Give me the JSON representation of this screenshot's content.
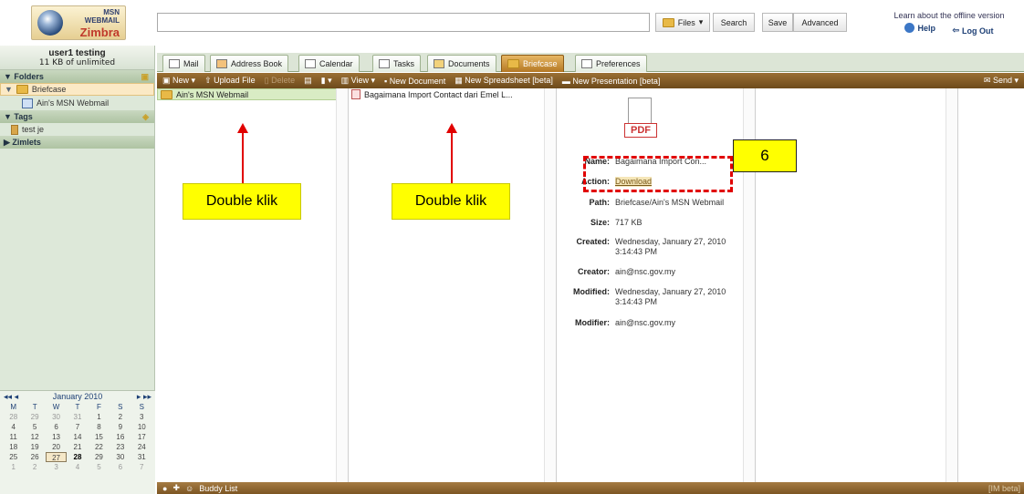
{
  "header": {
    "logo_msn": "MSN",
    "logo_webmail": "WEBMAIL",
    "logo_zimbra": "Zimbra",
    "search_value": "",
    "files_label": "Files",
    "search_button": "Search",
    "save_button": "Save",
    "advanced_button": "Advanced",
    "offline_text": "Learn about the offline version",
    "help_label": "Help",
    "logout_label": "Log Out"
  },
  "sidebar": {
    "user_name": "user1 testing",
    "quota": "11 KB of unlimited",
    "folders_label": "Folders",
    "briefcase_label": "Briefcase",
    "briefcase_child": "Ain's MSN Webmail",
    "tags_label": "Tags",
    "tag_item": "test je",
    "zimlets_label": "Zimlets"
  },
  "calendar": {
    "month": "January 2010",
    "day_names": [
      "M",
      "T",
      "W",
      "T",
      "F",
      "S",
      "S"
    ],
    "weeks": [
      [
        "28",
        "29",
        "30",
        "31",
        "1",
        "2",
        "3"
      ],
      [
        "4",
        "5",
        "6",
        "7",
        "8",
        "9",
        "10"
      ],
      [
        "11",
        "12",
        "13",
        "14",
        "15",
        "16",
        "17"
      ],
      [
        "18",
        "19",
        "20",
        "21",
        "22",
        "23",
        "24"
      ],
      [
        "25",
        "26",
        "27",
        "28",
        "29",
        "30",
        "31"
      ],
      [
        "1",
        "2",
        "3",
        "4",
        "5",
        "6",
        "7"
      ]
    ]
  },
  "tabs": [
    "Mail",
    "Address Book",
    "Calendar",
    "Tasks",
    "Documents",
    "Briefcase",
    "Preferences"
  ],
  "toolbar": {
    "new": "New",
    "upload": "Upload File",
    "delete": "Delete",
    "view": "View",
    "new_document": "New Document",
    "new_spreadsheet": "New Spreadsheet [beta]",
    "new_presentation": "New Presentation [beta]",
    "send": "Send"
  },
  "columns": {
    "col1_item": "Ain's MSN Webmail",
    "col2_item": "Bagaimana Import Contact dari Emel L..."
  },
  "details": {
    "icon_text": "PDF",
    "name_label": "Name:",
    "name_value": "Bagaimana Import Con...",
    "action_label": "Action:",
    "action_value": "Download",
    "path_label": "Path:",
    "path_value": "Briefcase/Ain's MSN Webmail",
    "size_label": "Size:",
    "size_value": "717 KB",
    "created_label": "Created:",
    "created_value_1": "Wednesday, January 27, 2010",
    "created_value_2": "3:14:43 PM",
    "creator_label": "Creator:",
    "creator_value": "ain@nsc.gov.my",
    "modified_label": "Modified:",
    "modified_value_1": "Wednesday, January 27, 2010",
    "modified_value_2": "3:14:43 PM",
    "modifier_label": "Modifier:",
    "modifier_value": "ain@nsc.gov.my"
  },
  "annotations": {
    "double_click_1": "Double klik",
    "double_click_2": "Double klik",
    "step_number": "6"
  },
  "bottom": {
    "buddy_list": "Buddy List",
    "im_beta": "[IM beta]"
  }
}
